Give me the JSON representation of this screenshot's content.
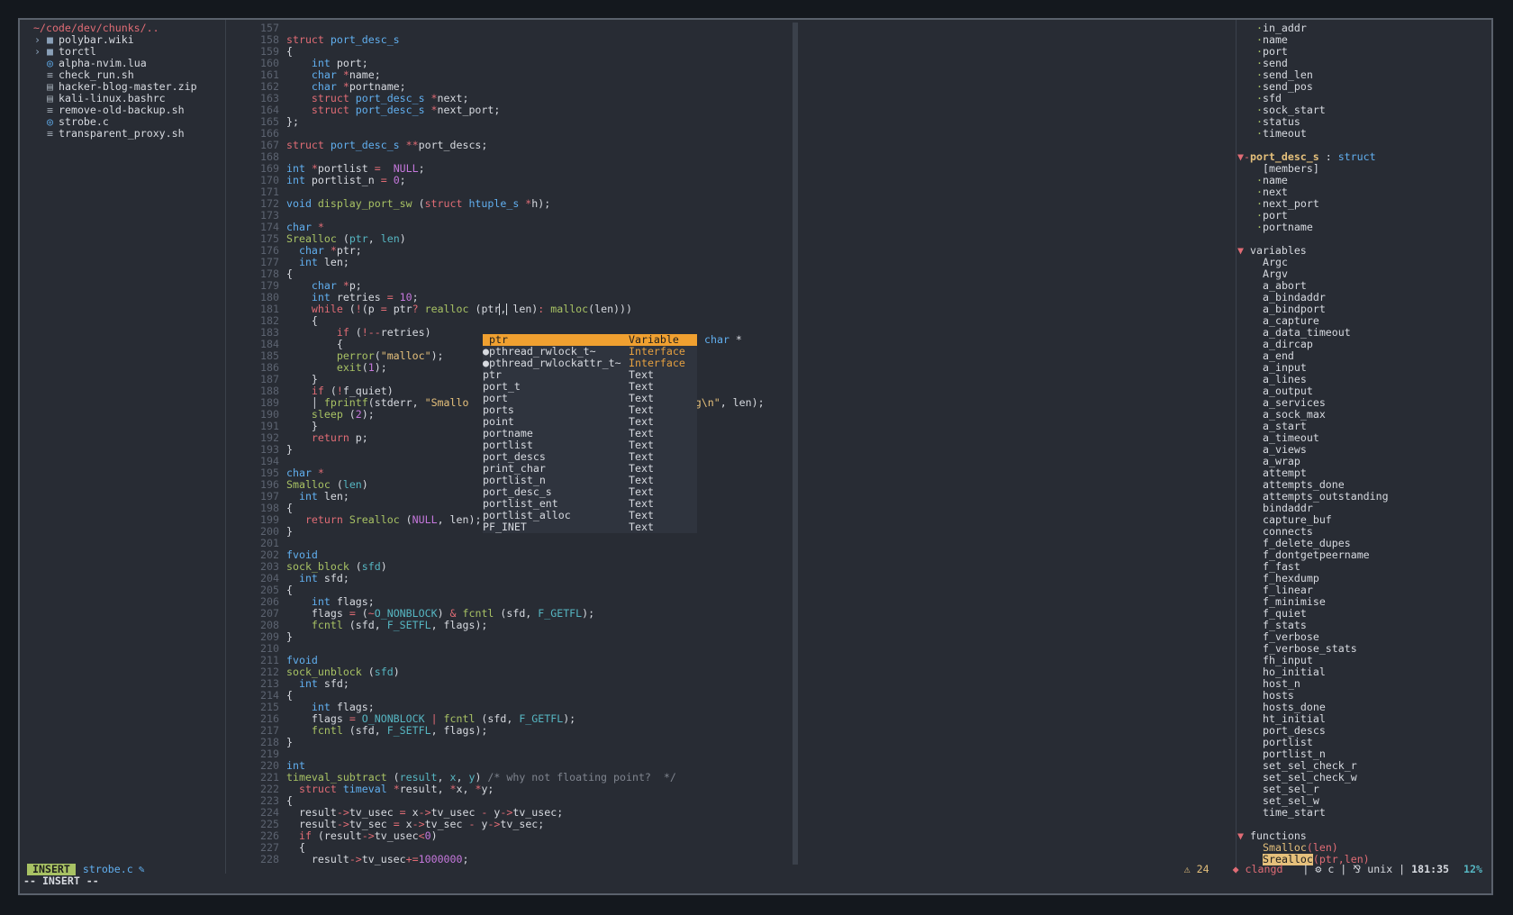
{
  "tree": {
    "root": "~/code/dev/chunks/..",
    "items": [
      {
        "icon": "folder-icon",
        "glyph": "› ■",
        "label": "polybar.wiki"
      },
      {
        "icon": "folder-icon",
        "glyph": "› ■",
        "label": "torctl"
      },
      {
        "icon": "lua-file-icon",
        "glyph": "◎",
        "label": "alpha-nvim.lua"
      },
      {
        "icon": "terminal-file-icon",
        "glyph": "≡",
        "label": "check_run.sh"
      },
      {
        "icon": "zip-file-icon",
        "glyph": "▤",
        "label": "hacker-blog-master.zip"
      },
      {
        "icon": "text-file-icon",
        "glyph": "▤",
        "label": "kali-linux.bashrc"
      },
      {
        "icon": "terminal-file-icon",
        "glyph": "≡",
        "label": "remove-old-backup.sh"
      },
      {
        "icon": "c-file-icon",
        "glyph": "◎",
        "label": "strobe.c"
      },
      {
        "icon": "terminal-file-icon",
        "glyph": "≡",
        "label": "transparent_proxy.sh"
      }
    ]
  },
  "editor": {
    "first_line": 157,
    "lines": [
      [],
      [
        [
          "kw",
          "struct "
        ],
        [
          "ty",
          "port_desc_s"
        ]
      ],
      [
        [
          "",
          "{"
        ]
      ],
      [
        [
          "",
          "    "
        ],
        [
          "ty",
          "int"
        ],
        [
          "",
          " port;"
        ]
      ],
      [
        [
          "",
          "    "
        ],
        [
          "ty",
          "char"
        ],
        [
          "op",
          " *"
        ],
        [
          "",
          "name;"
        ]
      ],
      [
        [
          "",
          "    "
        ],
        [
          "ty",
          "char"
        ],
        [
          "op",
          " *"
        ],
        [
          "",
          "portname;"
        ]
      ],
      [
        [
          "",
          "    "
        ],
        [
          "kw",
          "struct "
        ],
        [
          "ty",
          "port_desc_s"
        ],
        [
          "op",
          " *"
        ],
        [
          "",
          "next;"
        ]
      ],
      [
        [
          "",
          "    "
        ],
        [
          "kw",
          "struct "
        ],
        [
          "ty",
          "port_desc_s"
        ],
        [
          "op",
          " *"
        ],
        [
          "",
          "next_port;"
        ]
      ],
      [
        [
          "",
          "};"
        ]
      ],
      [],
      [
        [
          "kw",
          "struct "
        ],
        [
          "ty",
          "port_desc_s"
        ],
        [
          "op",
          " **"
        ],
        [
          "",
          "port_descs;"
        ]
      ],
      [],
      [
        [
          "ty",
          "int"
        ],
        [
          "op",
          " *"
        ],
        [
          "",
          "portlist "
        ],
        [
          "op",
          "="
        ],
        [
          "",
          "  "
        ],
        [
          "num",
          "NULL"
        ],
        [
          "",
          ";"
        ]
      ],
      [
        [
          "ty",
          "int"
        ],
        [
          "",
          " portlist_n "
        ],
        [
          "op",
          "="
        ],
        [
          "",
          " "
        ],
        [
          "num",
          "0"
        ],
        [
          "",
          ";"
        ]
      ],
      [],
      [
        [
          "ty",
          "void"
        ],
        [
          "",
          " "
        ],
        [
          "fn",
          "display_port_sw"
        ],
        [
          "",
          " ("
        ],
        [
          "kw",
          "struct "
        ],
        [
          "ty",
          "htuple_s"
        ],
        [
          "op",
          " *"
        ],
        [
          "",
          "h);"
        ]
      ],
      [],
      [
        [
          "ty",
          "char"
        ],
        [
          "op",
          " *"
        ]
      ],
      [
        [
          "fn",
          "Srealloc"
        ],
        [
          "",
          " ("
        ],
        [
          "ident",
          "ptr"
        ],
        [
          "",
          ", "
        ],
        [
          "ident",
          "len"
        ],
        [
          "",
          ")"
        ]
      ],
      [
        [
          "",
          "  "
        ],
        [
          "ty",
          "char"
        ],
        [
          "op",
          " *"
        ],
        [
          "",
          "ptr;"
        ]
      ],
      [
        [
          "",
          "  "
        ],
        [
          "ty",
          "int"
        ],
        [
          "",
          " len;"
        ]
      ],
      [
        [
          "",
          "{"
        ]
      ],
      [
        [
          "",
          "    "
        ],
        [
          "ty",
          "char"
        ],
        [
          "op",
          " *"
        ],
        [
          "",
          "p;"
        ]
      ],
      [
        [
          "",
          "    "
        ],
        [
          "ty",
          "int"
        ],
        [
          "",
          " retries "
        ],
        [
          "op",
          "="
        ],
        [
          "",
          " "
        ],
        [
          "num",
          "10"
        ],
        [
          "",
          ";"
        ]
      ],
      [
        [
          "",
          "    "
        ],
        [
          "kw",
          "while"
        ],
        [
          "",
          " ("
        ],
        [
          "op",
          "!"
        ],
        [
          "",
          "(p "
        ],
        [
          "op",
          "="
        ],
        [
          "",
          " ptr"
        ],
        [
          "op",
          "?"
        ],
        [
          "",
          " "
        ],
        [
          "fn",
          "realloc"
        ],
        [
          "",
          " (ptr"
        ],
        [
          "cursor",
          ","
        ],
        [
          "",
          " len)"
        ],
        [
          "op",
          ":"
        ],
        [
          "",
          " "
        ],
        [
          "fn",
          "malloc"
        ],
        [
          "",
          "(len)))"
        ]
      ],
      [
        [
          "",
          "    {"
        ]
      ],
      [
        [
          "",
          "        "
        ],
        [
          "kw",
          "if"
        ],
        [
          "",
          " ("
        ],
        [
          "op",
          "!--"
        ],
        [
          "",
          "retries)"
        ]
      ],
      [
        [
          "",
          "        {"
        ]
      ],
      [
        [
          "",
          "        "
        ],
        [
          "fn",
          "perror"
        ],
        [
          "",
          "("
        ],
        [
          "str",
          "\"malloc\""
        ],
        [
          "",
          ");"
        ]
      ],
      [
        [
          "",
          "        "
        ],
        [
          "fn",
          "exit"
        ],
        [
          "",
          "("
        ],
        [
          "num",
          "1"
        ],
        [
          "",
          ");"
        ]
      ],
      [
        [
          "",
          "    }"
        ]
      ],
      [
        [
          "",
          "    "
        ],
        [
          "kw",
          "if"
        ],
        [
          "",
          " ("
        ],
        [
          "op",
          "!"
        ],
        [
          "",
          "f_quiet)"
        ]
      ],
      [
        [
          "",
          "    │ "
        ],
        [
          "fn",
          "fprintf"
        ],
        [
          "",
          "(stderr, "
        ],
        [
          "str",
          "\"Smallo"
        ],
        [
          "",
          "                               "
        ],
        [
          "str",
          "eeping\\n\""
        ],
        [
          "",
          ", len);"
        ]
      ],
      [
        [
          "",
          "    "
        ],
        [
          "fn",
          "sleep"
        ],
        [
          "",
          " ("
        ],
        [
          "num",
          "2"
        ],
        [
          "",
          ");"
        ]
      ],
      [
        [
          "",
          "    }"
        ]
      ],
      [
        [
          "",
          "    "
        ],
        [
          "kw",
          "return"
        ],
        [
          "",
          " p;"
        ]
      ],
      [
        [
          "",
          "}"
        ]
      ],
      [],
      [
        [
          "ty",
          "char"
        ],
        [
          "op",
          " *"
        ]
      ],
      [
        [
          "fn",
          "Smalloc"
        ],
        [
          "",
          " ("
        ],
        [
          "ident",
          "len"
        ],
        [
          "",
          ")"
        ]
      ],
      [
        [
          "",
          "  "
        ],
        [
          "ty",
          "int"
        ],
        [
          "",
          " len;"
        ]
      ],
      [
        [
          "",
          "{"
        ]
      ],
      [
        [
          "",
          "   "
        ],
        [
          "kw",
          "return"
        ],
        [
          "",
          " "
        ],
        [
          "fn",
          "Srealloc"
        ],
        [
          "",
          " ("
        ],
        [
          "num",
          "NULL"
        ],
        [
          "",
          ", len);"
        ]
      ],
      [
        [
          "",
          "}"
        ]
      ],
      [],
      [
        [
          "ty",
          "fvoid"
        ]
      ],
      [
        [
          "fn",
          "sock_block"
        ],
        [
          "",
          " ("
        ],
        [
          "ident",
          "sfd"
        ],
        [
          "",
          ")"
        ]
      ],
      [
        [
          "",
          "  "
        ],
        [
          "ty",
          "int"
        ],
        [
          "",
          " sfd;"
        ]
      ],
      [
        [
          "",
          "{"
        ]
      ],
      [
        [
          "",
          "    "
        ],
        [
          "ty",
          "int"
        ],
        [
          "",
          " flags;"
        ]
      ],
      [
        [
          "",
          "    flags "
        ],
        [
          "op",
          "="
        ],
        [
          "",
          " ("
        ],
        [
          "op",
          "~"
        ],
        [
          "ident",
          "O_NONBLOCK"
        ],
        [
          "",
          ") "
        ],
        [
          "op",
          "&"
        ],
        [
          "",
          " "
        ],
        [
          "fn",
          "fcntl"
        ],
        [
          "",
          " (sfd, "
        ],
        [
          "ident",
          "F_GETFL"
        ],
        [
          "",
          ");"
        ]
      ],
      [
        [
          "",
          "    "
        ],
        [
          "fn",
          "fcntl"
        ],
        [
          "",
          " (sfd, "
        ],
        [
          "ident",
          "F_SETFL"
        ],
        [
          "",
          ", flags);"
        ]
      ],
      [
        [
          "",
          "}"
        ]
      ],
      [],
      [
        [
          "ty",
          "fvoid"
        ]
      ],
      [
        [
          "fn",
          "sock_unblock"
        ],
        [
          "",
          " ("
        ],
        [
          "ident",
          "sfd"
        ],
        [
          "",
          ")"
        ]
      ],
      [
        [
          "",
          "  "
        ],
        [
          "ty",
          "int"
        ],
        [
          "",
          " sfd;"
        ]
      ],
      [
        [
          "",
          "{"
        ]
      ],
      [
        [
          "",
          "    "
        ],
        [
          "ty",
          "int"
        ],
        [
          "",
          " flags;"
        ]
      ],
      [
        [
          "",
          "    flags "
        ],
        [
          "op",
          "="
        ],
        [
          "",
          " "
        ],
        [
          "ident",
          "O_NONBLOCK"
        ],
        [
          "",
          " "
        ],
        [
          "op",
          "|"
        ],
        [
          "",
          " "
        ],
        [
          "fn",
          "fcntl"
        ],
        [
          "",
          " (sfd, "
        ],
        [
          "ident",
          "F_GETFL"
        ],
        [
          "",
          ");"
        ]
      ],
      [
        [
          "",
          "    "
        ],
        [
          "fn",
          "fcntl"
        ],
        [
          "",
          " (sfd, "
        ],
        [
          "ident",
          "F_SETFL"
        ],
        [
          "",
          ", flags);"
        ]
      ],
      [
        [
          "",
          "}"
        ]
      ],
      [],
      [
        [
          "ty",
          "int"
        ]
      ],
      [
        [
          "fn",
          "timeval_subtract"
        ],
        [
          "",
          " ("
        ],
        [
          "ident",
          "result"
        ],
        [
          "",
          ", "
        ],
        [
          "ident",
          "x"
        ],
        [
          "",
          ", "
        ],
        [
          "ident",
          "y"
        ],
        [
          "",
          ") "
        ],
        [
          "cmt",
          "/* why not floating point?  */"
        ]
      ],
      [
        [
          "",
          "  "
        ],
        [
          "kw",
          "struct "
        ],
        [
          "ty",
          "timeval"
        ],
        [
          "op",
          " *"
        ],
        [
          "",
          "result, "
        ],
        [
          "op",
          "*"
        ],
        [
          "",
          "x, "
        ],
        [
          "op",
          "*"
        ],
        [
          "",
          "y;"
        ]
      ],
      [
        [
          "",
          "{"
        ]
      ],
      [
        [
          "",
          "  result"
        ],
        [
          "op",
          "->"
        ],
        [
          "",
          "tv_usec "
        ],
        [
          "op",
          "="
        ],
        [
          "",
          " x"
        ],
        [
          "op",
          "->"
        ],
        [
          "",
          "tv_usec "
        ],
        [
          "op",
          "-"
        ],
        [
          "",
          " y"
        ],
        [
          "op",
          "->"
        ],
        [
          "",
          "tv_usec;"
        ]
      ],
      [
        [
          "",
          "  result"
        ],
        [
          "op",
          "->"
        ],
        [
          "",
          "tv_sec "
        ],
        [
          "op",
          "="
        ],
        [
          "",
          " x"
        ],
        [
          "op",
          "->"
        ],
        [
          "",
          "tv_sec "
        ],
        [
          "op",
          "-"
        ],
        [
          "",
          " y"
        ],
        [
          "op",
          "->"
        ],
        [
          "",
          "tv_sec;"
        ]
      ],
      [
        [
          "",
          "  "
        ],
        [
          "kw",
          "if"
        ],
        [
          "",
          " (result"
        ],
        [
          "op",
          "->"
        ],
        [
          "",
          "tv_usec"
        ],
        [
          "op",
          "<"
        ],
        [
          "num",
          "0"
        ],
        [
          "",
          ")"
        ]
      ],
      [
        [
          "",
          "  {"
        ]
      ],
      [
        [
          "",
          "    result"
        ],
        [
          "op",
          "->"
        ],
        [
          "",
          "tv_usec"
        ],
        [
          "op",
          "+="
        ],
        [
          "num",
          "1000000"
        ],
        [
          "",
          ";"
        ]
      ]
    ]
  },
  "popup": {
    "items": [
      {
        "word": " ptr",
        "kind": "Variable",
        "selected": true
      },
      {
        "word": "●pthread_rwlock_t~",
        "kind": "Interface",
        "iface": true
      },
      {
        "word": "●pthread_rwlockattr_t~",
        "kind": "Interface",
        "iface": true
      },
      {
        "word": "ptr",
        "kind": "Text"
      },
      {
        "word": "port_t",
        "kind": "Text"
      },
      {
        "word": "port",
        "kind": "Text"
      },
      {
        "word": "ports",
        "kind": "Text"
      },
      {
        "word": "point",
        "kind": "Text"
      },
      {
        "word": "portname",
        "kind": "Text"
      },
      {
        "word": "portlist",
        "kind": "Text"
      },
      {
        "word": "port_descs",
        "kind": "Text"
      },
      {
        "word": "print_char",
        "kind": "Text"
      },
      {
        "word": "portlist_n",
        "kind": "Text"
      },
      {
        "word": "port_desc_s",
        "kind": "Text"
      },
      {
        "word": "portlist_ent",
        "kind": "Text"
      },
      {
        "word": "portlist_alloc",
        "kind": "Text"
      },
      {
        "word": "PF_INET",
        "kind": "Text"
      }
    ],
    "hint_type": "char",
    "hint_ptr": " *"
  },
  "tagbar": {
    "top_members": [
      "in_addr",
      "name",
      "port",
      "send",
      "send_len",
      "send_pos",
      "sfd",
      "sock_start",
      "status",
      "timeout"
    ],
    "struct_name": "port_desc_s",
    "struct_suffix": " : ",
    "struct_kind": "struct",
    "members_label": "[members]",
    "struct_members": [
      "name",
      "next",
      "next_port",
      "port",
      "portname"
    ],
    "variables_label": "variables",
    "variables": [
      "Argc",
      "Argv",
      "a_abort",
      "a_bindaddr",
      "a_bindport",
      "a_capture",
      "a_data_timeout",
      "a_dircap",
      "a_end",
      "a_input",
      "a_lines",
      "a_output",
      "a_services",
      "a_sock_max",
      "a_start",
      "a_timeout",
      "a_views",
      "a_wrap",
      "attempt",
      "attempts_done",
      "attempts_outstanding",
      "bindaddr",
      "capture_buf",
      "connects",
      "f_delete_dupes",
      "f_dontgetpeername",
      "f_fast",
      "f_hexdump",
      "f_linear",
      "f_minimise",
      "f_quiet",
      "f_stats",
      "f_verbose",
      "f_verbose_stats",
      "fh_input",
      "ho_initial",
      "host_n",
      "hosts",
      "hosts_done",
      "ht_initial",
      "port_descs",
      "portlist",
      "portlist_n",
      "set_sel_check_r",
      "set_sel_check_w",
      "set_sel_r",
      "set_sel_w",
      "time_start"
    ],
    "functions_label": "functions",
    "fn1_name": "Smalloc",
    "fn1_args": "(len)",
    "fn2_name": "Srealloc",
    "fn2_args": "(ptr,len)"
  },
  "statusline": {
    "mode": "INSERT",
    "file": "strobe.c",
    "warn": "⚠ 24",
    "lsp": "◆ clangd",
    "ftype": "| ⚙ c | ⅋ unix |",
    "pos": " 181:35",
    "pct": "12%"
  },
  "cmdline": "-- INSERT --"
}
